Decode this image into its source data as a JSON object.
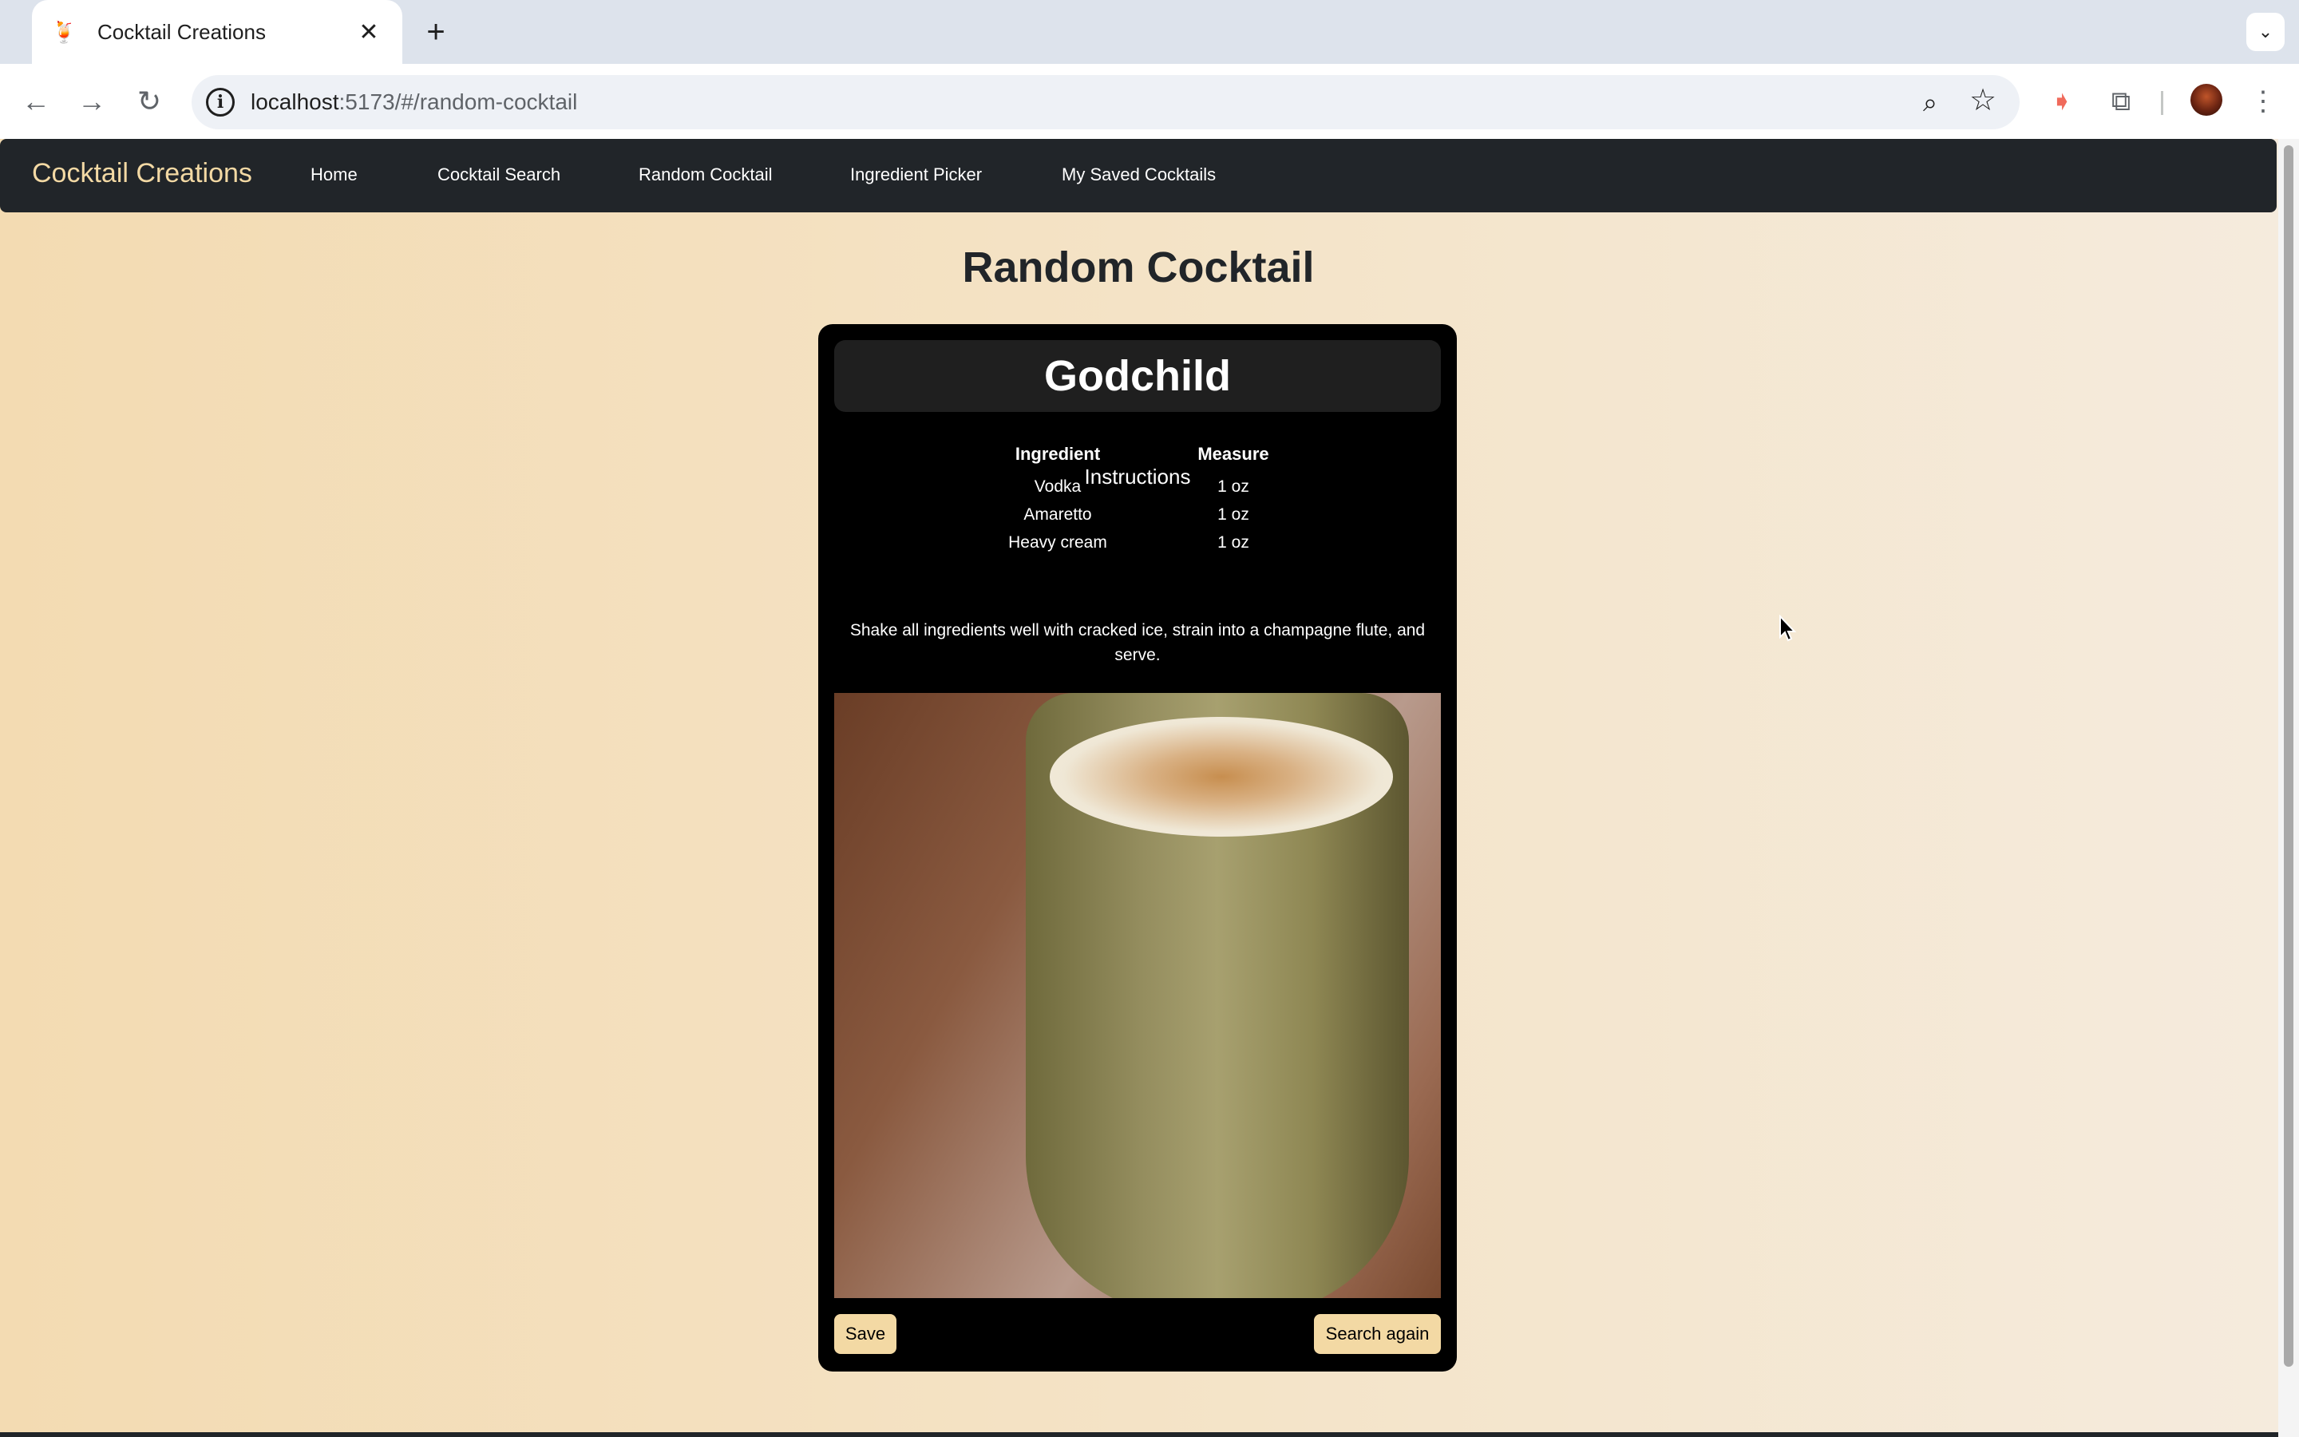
{
  "browser": {
    "tab_title": "Cocktail Creations",
    "url_host": "localhost",
    "url_rest": ":5173/#/random-cocktail"
  },
  "app": {
    "brand": "Cocktail Creations",
    "nav": [
      "Home",
      "Cocktail Search",
      "Random Cocktail",
      "Ingredient Picker",
      "My Saved Cocktails"
    ]
  },
  "page": {
    "title": "Random Cocktail"
  },
  "cocktail": {
    "name": "Godchild",
    "ingredient_header": "Ingredient",
    "measure_header": "Measure",
    "ingredients": [
      {
        "name": "Vodka",
        "measure": "1 oz"
      },
      {
        "name": "Amaretto",
        "measure": "1 oz"
      },
      {
        "name": "Heavy cream",
        "measure": "1 oz"
      }
    ],
    "instructions_title": "Instructions",
    "instructions": "Shake all ingredients well with cracked ice, strain into a champagne flute, and serve."
  },
  "actions": {
    "save": "Save",
    "search_again": "Search again"
  },
  "colors": {
    "navbar": "#212529",
    "brand": "#f3d9a4",
    "button": "#f3d9a4",
    "card": "#000000"
  }
}
